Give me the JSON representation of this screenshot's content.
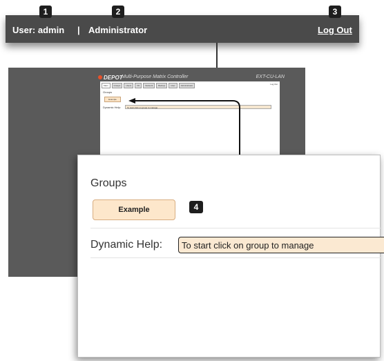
{
  "topbar": {
    "user_label": "User: admin",
    "separator": "|",
    "role": "Administrator",
    "logout": "Log Out"
  },
  "callouts": [
    "1",
    "2",
    "3",
    "4"
  ],
  "background_app": {
    "brand": "DEPOT",
    "product": "Multi-Purpose Matrix Controller",
    "model": "EXT-CU-LAN",
    "tabs": [
      "Main",
      "Groups",
      "Users",
      "I/O",
      "Network",
      "Backup",
      "User",
      "Administrator"
    ],
    "logout_mini": "Log Out",
    "groups_heading": "Groups",
    "example_label": "Example",
    "help_label": "Dynamic Help:",
    "help_text": "To start click on group to manage"
  },
  "zoom": {
    "groups_heading": "Groups",
    "example_label": "Example",
    "help_label": "Dynamic Help:",
    "help_text": "To start click on group to manage"
  },
  "colors": {
    "bar": "#4a4a4a",
    "window_bg": "#5a5a5a",
    "button_fill": "#fde7cb",
    "field_fill": "#fbe9d2"
  }
}
